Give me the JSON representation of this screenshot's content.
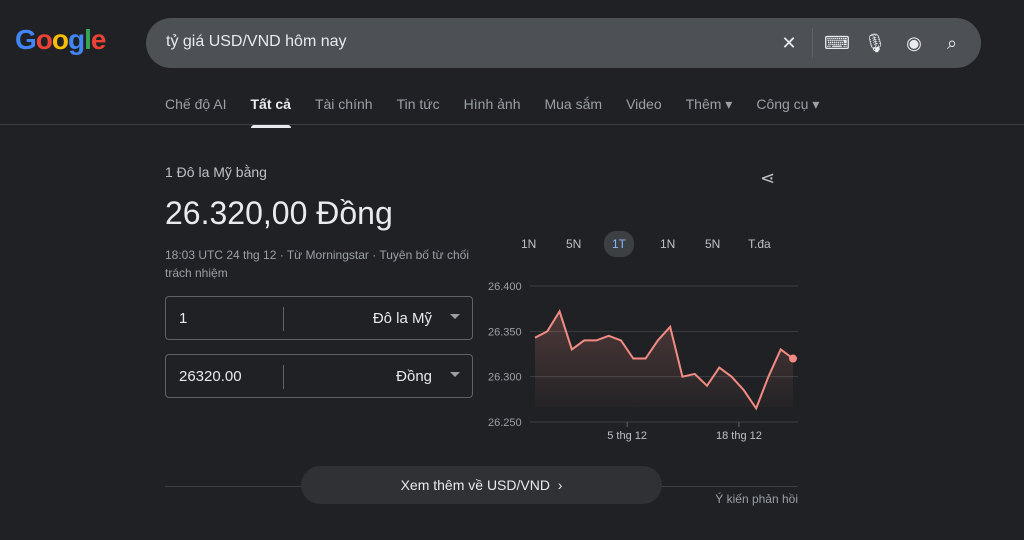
{
  "logo": "Google",
  "search": {
    "query": "tỷ giá USD/VND hôm nay"
  },
  "tabs": [
    "Chế độ AI",
    "Tất cả",
    "Tài chính",
    "Tin tức",
    "Hình ảnh",
    "Mua sắm",
    "Video",
    "Thêm ▾",
    "Công cụ ▾"
  ],
  "result": {
    "subtitle": "1 Đô la Mỹ bằng",
    "value": "26.320,00 Đồng",
    "meta": "18:03 UTC 24 thg 12 · Từ Morningstar · Tuyên bố từ chối trách nhiệm"
  },
  "converter": [
    {
      "amount": "1",
      "currency": "Đô la Mỹ"
    },
    {
      "amount": "26320.00",
      "currency": "Đồng"
    }
  ],
  "ranges": [
    "1N",
    "5N",
    "1T",
    "1N",
    "5N",
    "T.đa"
  ],
  "more_button": "Xem thêm về USD/VND",
  "feedback": "Ý kiến phản hồi",
  "colors": {
    "line": "#f28b82",
    "active_range": "#8ab4f8"
  },
  "chart_data": {
    "type": "line",
    "values": [
      26343,
      26350,
      26372,
      26330,
      26340,
      26340,
      26345,
      26340,
      26320,
      26320,
      26340,
      26355,
      26300,
      26303,
      26290,
      26310,
      26300,
      26285,
      26265,
      26300,
      26330,
      26320
    ],
    "yticks": [
      "26.400",
      "26.350",
      "26.300",
      "26.250"
    ],
    "ytick_values": [
      26400,
      26350,
      26300,
      26250
    ],
    "ylim": [
      26250,
      26400
    ],
    "xticks": [
      {
        "label": "5 thg 12",
        "index": 7.5
      },
      {
        "label": "18 thg 12",
        "index": 16.6
      }
    ]
  }
}
